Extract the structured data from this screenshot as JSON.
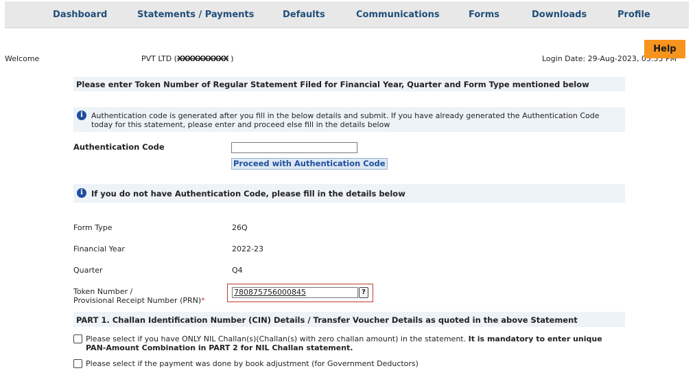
{
  "nav": {
    "items": [
      "Dashboard",
      "Statements / Payments",
      "Defaults",
      "Communications",
      "Forms",
      "Downloads",
      "Profile"
    ]
  },
  "header": {
    "welcome": "Welcome",
    "company_prefix": "PVT LTD (",
    "company_masked": "XXXXXXXXXX",
    "company_suffix": " )",
    "login_date": "Login Date: 29-Aug-2023, 05:53 PM",
    "help": "Help"
  },
  "sections": {
    "token_title": "Please enter Token Number of Regular Statement Filed for Financial Year, Quarter and Form Type mentioned below",
    "auth_info_line1": "Authentication code is generated after you fill in the below details and submit. If you have already generated the Authentication Code",
    "auth_info_line2": "today for this statement, please enter and proceed else fill in the details below",
    "no_auth_info": "If you do not have Authentication Code, please fill in the details below",
    "part1_title": "PART 1. Challan Identification Number (CIN) Details / Transfer Voucher Details as quoted in the above Statement"
  },
  "auth": {
    "label": "Authentication Code",
    "value": "",
    "proceed_button": "Proceed with Authentication Code"
  },
  "details": {
    "form_type_label": "Form Type",
    "form_type_value": "26Q",
    "fy_label": "Financial Year",
    "fy_value": "2022-23",
    "quarter_label": "Quarter",
    "quarter_value": "Q4",
    "token_label_line1": "Token Number /",
    "token_label_line2": "Provisional Receipt Number (PRN)",
    "token_required": "*",
    "token_value": "780875756000845",
    "help_glyph": "?"
  },
  "checkboxes": {
    "nil_challan_text": "Please select if you have ONLY NIL Challan(s)(Challan(s) with zero challan amount) in the statement.",
    "nil_challan_bold_1": "It is mandatory to enter unique",
    "nil_challan_bold_2": "PAN-Amount Combination in PART 2 for NIL Challan statement.",
    "book_adjustment_text": "Please select if the payment was done by book adjustment (for Government Deductors)"
  },
  "icons": {
    "info": "info-icon",
    "question": "question-icon"
  },
  "colors": {
    "nav_text": "#1f4e79",
    "help_button": "#f7941d",
    "section_bg": "#eef3f8",
    "required": "#c0392b"
  }
}
